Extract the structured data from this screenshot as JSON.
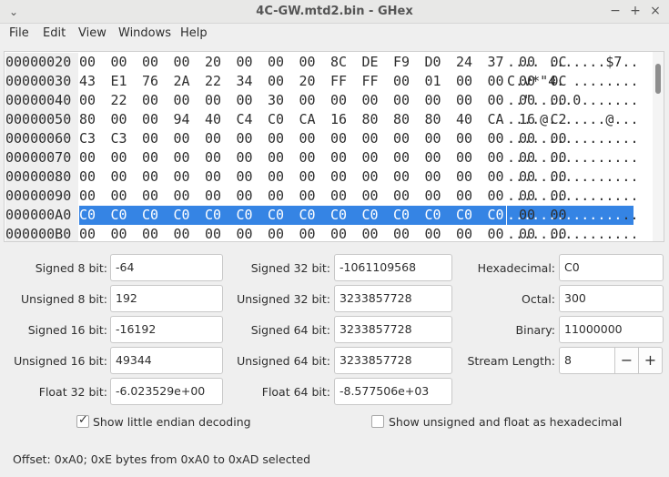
{
  "window": {
    "title": "4C-GW.mtd2.bin - GHex",
    "menu_icon": "chevron-down-icon",
    "controls": [
      "minimize",
      "maximize",
      "close"
    ]
  },
  "menubar": {
    "items": [
      "File",
      "Edit",
      "View",
      "Windows",
      "Help"
    ]
  },
  "hex": {
    "rows": [
      {
        "addr": "00000020",
        "bytes": [
          "00",
          "00",
          "00",
          "00",
          "20",
          "00",
          "00",
          "00",
          "8C",
          "DE",
          "F9",
          "D0",
          "24",
          "37",
          "00",
          "0C"
        ],
        "ascii": ".... .......$7.."
      },
      {
        "addr": "00000030",
        "bytes": [
          "43",
          "E1",
          "76",
          "2A",
          "22",
          "34",
          "00",
          "20",
          "FF",
          "FF",
          "00",
          "01",
          "00",
          "00",
          "00",
          "0C"
        ],
        "ascii": "C.v*\"4. ........"
      },
      {
        "addr": "00000040",
        "bytes": [
          "00",
          "22",
          "00",
          "00",
          "00",
          "00",
          "30",
          "00",
          "00",
          "00",
          "00",
          "00",
          "00",
          "00",
          "00",
          "00"
        ],
        "ascii": "..\".....0......."
      },
      {
        "addr": "00000050",
        "bytes": [
          "80",
          "00",
          "00",
          "94",
          "40",
          "C4",
          "C0",
          "CA",
          "16",
          "80",
          "80",
          "80",
          "40",
          "CA",
          "16",
          "C2"
        ],
        "ascii": "....@.......@..."
      },
      {
        "addr": "00000060",
        "bytes": [
          "C3",
          "C3",
          "00",
          "00",
          "00",
          "00",
          "00",
          "00",
          "00",
          "00",
          "00",
          "00",
          "00",
          "00",
          "00",
          "00"
        ],
        "ascii": "................"
      },
      {
        "addr": "00000070",
        "bytes": [
          "00",
          "00",
          "00",
          "00",
          "00",
          "00",
          "00",
          "00",
          "00",
          "00",
          "00",
          "00",
          "00",
          "00",
          "00",
          "00"
        ],
        "ascii": "................"
      },
      {
        "addr": "00000080",
        "bytes": [
          "00",
          "00",
          "00",
          "00",
          "00",
          "00",
          "00",
          "00",
          "00",
          "00",
          "00",
          "00",
          "00",
          "00",
          "00",
          "00"
        ],
        "ascii": "................"
      },
      {
        "addr": "00000090",
        "bytes": [
          "00",
          "00",
          "00",
          "00",
          "00",
          "00",
          "00",
          "00",
          "00",
          "00",
          "00",
          "00",
          "00",
          "00",
          "00",
          "00"
        ],
        "ascii": "................"
      },
      {
        "addr": "000000A0",
        "bytes": [
          "C0",
          "C0",
          "C0",
          "C0",
          "C0",
          "C0",
          "C0",
          "C0",
          "C0",
          "C0",
          "C0",
          "C0",
          "C0",
          "C0",
          "00",
          "00"
        ],
        "ascii": "................",
        "selected_count": 14
      },
      {
        "addr": "000000B0",
        "bytes": [
          "00",
          "00",
          "00",
          "00",
          "00",
          "00",
          "00",
          "00",
          "00",
          "00",
          "00",
          "00",
          "00",
          "00",
          "00",
          "00"
        ],
        "ascii": "................"
      }
    ]
  },
  "conversions": {
    "signed8": {
      "label": "Signed 8 bit:",
      "value": "-64"
    },
    "unsigned8": {
      "label": "Unsigned 8 bit:",
      "value": "192"
    },
    "signed16": {
      "label": "Signed 16 bit:",
      "value": "-16192"
    },
    "unsigned16": {
      "label": "Unsigned 16 bit:",
      "value": "49344"
    },
    "float32": {
      "label": "Float 32 bit:",
      "value": "-6.023529e+00"
    },
    "signed32": {
      "label": "Signed 32 bit:",
      "value": "-1061109568"
    },
    "unsigned32": {
      "label": "Unsigned 32 bit:",
      "value": "3233857728"
    },
    "signed64": {
      "label": "Signed 64 bit:",
      "value": "3233857728"
    },
    "unsigned64": {
      "label": "Unsigned 64 bit:",
      "value": "3233857728"
    },
    "float64": {
      "label": "Float 64 bit:",
      "value": "-8.577506e+03"
    },
    "hex": {
      "label": "Hexadecimal:",
      "value": "C0"
    },
    "octal": {
      "label": "Octal:",
      "value": "300"
    },
    "binary": {
      "label": "Binary:",
      "value": "11000000"
    },
    "stream_length": {
      "label": "Stream Length:",
      "value": "8",
      "minus": "−",
      "plus": "+"
    }
  },
  "options": {
    "little_endian": {
      "label": "Show little endian decoding",
      "checked": true
    },
    "unsigned_hex": {
      "label": "Show unsigned and float as hexadecimal",
      "checked": false
    }
  },
  "status": {
    "text": "Offset: 0xA0; 0xE bytes from 0xA0 to 0xAD selected"
  },
  "colors": {
    "selection": "#3584e4",
    "background": "#efefef"
  }
}
